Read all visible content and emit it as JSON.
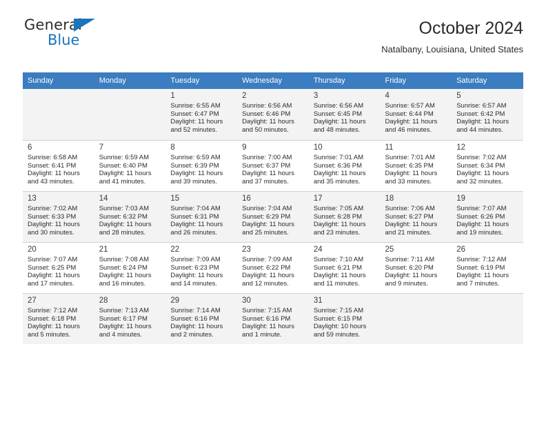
{
  "brand": {
    "line1": "General",
    "line2": "Blue",
    "accent": "#1b75bb",
    "triangle_icon": "triangle-logo-icon"
  },
  "header": {
    "title": "October 2024",
    "location": "Natalbany, Louisiana, United States"
  },
  "theme": {
    "header_row_bg": "#3b7dc0",
    "header_row_text": "#ffffff",
    "alt_row_bg": "#f3f3f3",
    "grid_line": "#d0d0d0"
  },
  "calendar": {
    "weekday_headers": [
      "Sunday",
      "Monday",
      "Tuesday",
      "Wednesday",
      "Thursday",
      "Friday",
      "Saturday"
    ],
    "weeks": [
      [
        {
          "day": "",
          "sunrise": "",
          "sunset": "",
          "daylight1": "",
          "daylight2": ""
        },
        {
          "day": "",
          "sunrise": "",
          "sunset": "",
          "daylight1": "",
          "daylight2": ""
        },
        {
          "day": "1",
          "sunrise": "Sunrise: 6:55 AM",
          "sunset": "Sunset: 6:47 PM",
          "daylight1": "Daylight: 11 hours",
          "daylight2": "and 52 minutes."
        },
        {
          "day": "2",
          "sunrise": "Sunrise: 6:56 AM",
          "sunset": "Sunset: 6:46 PM",
          "daylight1": "Daylight: 11 hours",
          "daylight2": "and 50 minutes."
        },
        {
          "day": "3",
          "sunrise": "Sunrise: 6:56 AM",
          "sunset": "Sunset: 6:45 PM",
          "daylight1": "Daylight: 11 hours",
          "daylight2": "and 48 minutes."
        },
        {
          "day": "4",
          "sunrise": "Sunrise: 6:57 AM",
          "sunset": "Sunset: 6:44 PM",
          "daylight1": "Daylight: 11 hours",
          "daylight2": "and 46 minutes."
        },
        {
          "day": "5",
          "sunrise": "Sunrise: 6:57 AM",
          "sunset": "Sunset: 6:42 PM",
          "daylight1": "Daylight: 11 hours",
          "daylight2": "and 44 minutes."
        }
      ],
      [
        {
          "day": "6",
          "sunrise": "Sunrise: 6:58 AM",
          "sunset": "Sunset: 6:41 PM",
          "daylight1": "Daylight: 11 hours",
          "daylight2": "and 43 minutes."
        },
        {
          "day": "7",
          "sunrise": "Sunrise: 6:59 AM",
          "sunset": "Sunset: 6:40 PM",
          "daylight1": "Daylight: 11 hours",
          "daylight2": "and 41 minutes."
        },
        {
          "day": "8",
          "sunrise": "Sunrise: 6:59 AM",
          "sunset": "Sunset: 6:39 PM",
          "daylight1": "Daylight: 11 hours",
          "daylight2": "and 39 minutes."
        },
        {
          "day": "9",
          "sunrise": "Sunrise: 7:00 AM",
          "sunset": "Sunset: 6:37 PM",
          "daylight1": "Daylight: 11 hours",
          "daylight2": "and 37 minutes."
        },
        {
          "day": "10",
          "sunrise": "Sunrise: 7:01 AM",
          "sunset": "Sunset: 6:36 PM",
          "daylight1": "Daylight: 11 hours",
          "daylight2": "and 35 minutes."
        },
        {
          "day": "11",
          "sunrise": "Sunrise: 7:01 AM",
          "sunset": "Sunset: 6:35 PM",
          "daylight1": "Daylight: 11 hours",
          "daylight2": "and 33 minutes."
        },
        {
          "day": "12",
          "sunrise": "Sunrise: 7:02 AM",
          "sunset": "Sunset: 6:34 PM",
          "daylight1": "Daylight: 11 hours",
          "daylight2": "and 32 minutes."
        }
      ],
      [
        {
          "day": "13",
          "sunrise": "Sunrise: 7:02 AM",
          "sunset": "Sunset: 6:33 PM",
          "daylight1": "Daylight: 11 hours",
          "daylight2": "and 30 minutes."
        },
        {
          "day": "14",
          "sunrise": "Sunrise: 7:03 AM",
          "sunset": "Sunset: 6:32 PM",
          "daylight1": "Daylight: 11 hours",
          "daylight2": "and 28 minutes."
        },
        {
          "day": "15",
          "sunrise": "Sunrise: 7:04 AM",
          "sunset": "Sunset: 6:31 PM",
          "daylight1": "Daylight: 11 hours",
          "daylight2": "and 26 minutes."
        },
        {
          "day": "16",
          "sunrise": "Sunrise: 7:04 AM",
          "sunset": "Sunset: 6:29 PM",
          "daylight1": "Daylight: 11 hours",
          "daylight2": "and 25 minutes."
        },
        {
          "day": "17",
          "sunrise": "Sunrise: 7:05 AM",
          "sunset": "Sunset: 6:28 PM",
          "daylight1": "Daylight: 11 hours",
          "daylight2": "and 23 minutes."
        },
        {
          "day": "18",
          "sunrise": "Sunrise: 7:06 AM",
          "sunset": "Sunset: 6:27 PM",
          "daylight1": "Daylight: 11 hours",
          "daylight2": "and 21 minutes."
        },
        {
          "day": "19",
          "sunrise": "Sunrise: 7:07 AM",
          "sunset": "Sunset: 6:26 PM",
          "daylight1": "Daylight: 11 hours",
          "daylight2": "and 19 minutes."
        }
      ],
      [
        {
          "day": "20",
          "sunrise": "Sunrise: 7:07 AM",
          "sunset": "Sunset: 6:25 PM",
          "daylight1": "Daylight: 11 hours",
          "daylight2": "and 17 minutes."
        },
        {
          "day": "21",
          "sunrise": "Sunrise: 7:08 AM",
          "sunset": "Sunset: 6:24 PM",
          "daylight1": "Daylight: 11 hours",
          "daylight2": "and 16 minutes."
        },
        {
          "day": "22",
          "sunrise": "Sunrise: 7:09 AM",
          "sunset": "Sunset: 6:23 PM",
          "daylight1": "Daylight: 11 hours",
          "daylight2": "and 14 minutes."
        },
        {
          "day": "23",
          "sunrise": "Sunrise: 7:09 AM",
          "sunset": "Sunset: 6:22 PM",
          "daylight1": "Daylight: 11 hours",
          "daylight2": "and 12 minutes."
        },
        {
          "day": "24",
          "sunrise": "Sunrise: 7:10 AM",
          "sunset": "Sunset: 6:21 PM",
          "daylight1": "Daylight: 11 hours",
          "daylight2": "and 11 minutes."
        },
        {
          "day": "25",
          "sunrise": "Sunrise: 7:11 AM",
          "sunset": "Sunset: 6:20 PM",
          "daylight1": "Daylight: 11 hours",
          "daylight2": "and 9 minutes."
        },
        {
          "day": "26",
          "sunrise": "Sunrise: 7:12 AM",
          "sunset": "Sunset: 6:19 PM",
          "daylight1": "Daylight: 11 hours",
          "daylight2": "and 7 minutes."
        }
      ],
      [
        {
          "day": "27",
          "sunrise": "Sunrise: 7:12 AM",
          "sunset": "Sunset: 6:18 PM",
          "daylight1": "Daylight: 11 hours",
          "daylight2": "and 5 minutes."
        },
        {
          "day": "28",
          "sunrise": "Sunrise: 7:13 AM",
          "sunset": "Sunset: 6:17 PM",
          "daylight1": "Daylight: 11 hours",
          "daylight2": "and 4 minutes."
        },
        {
          "day": "29",
          "sunrise": "Sunrise: 7:14 AM",
          "sunset": "Sunset: 6:16 PM",
          "daylight1": "Daylight: 11 hours",
          "daylight2": "and 2 minutes."
        },
        {
          "day": "30",
          "sunrise": "Sunrise: 7:15 AM",
          "sunset": "Sunset: 6:16 PM",
          "daylight1": "Daylight: 11 hours",
          "daylight2": "and 1 minute."
        },
        {
          "day": "31",
          "sunrise": "Sunrise: 7:15 AM",
          "sunset": "Sunset: 6:15 PM",
          "daylight1": "Daylight: 10 hours",
          "daylight2": "and 59 minutes."
        },
        {
          "day": "",
          "sunrise": "",
          "sunset": "",
          "daylight1": "",
          "daylight2": ""
        },
        {
          "day": "",
          "sunrise": "",
          "sunset": "",
          "daylight1": "",
          "daylight2": ""
        }
      ]
    ]
  }
}
